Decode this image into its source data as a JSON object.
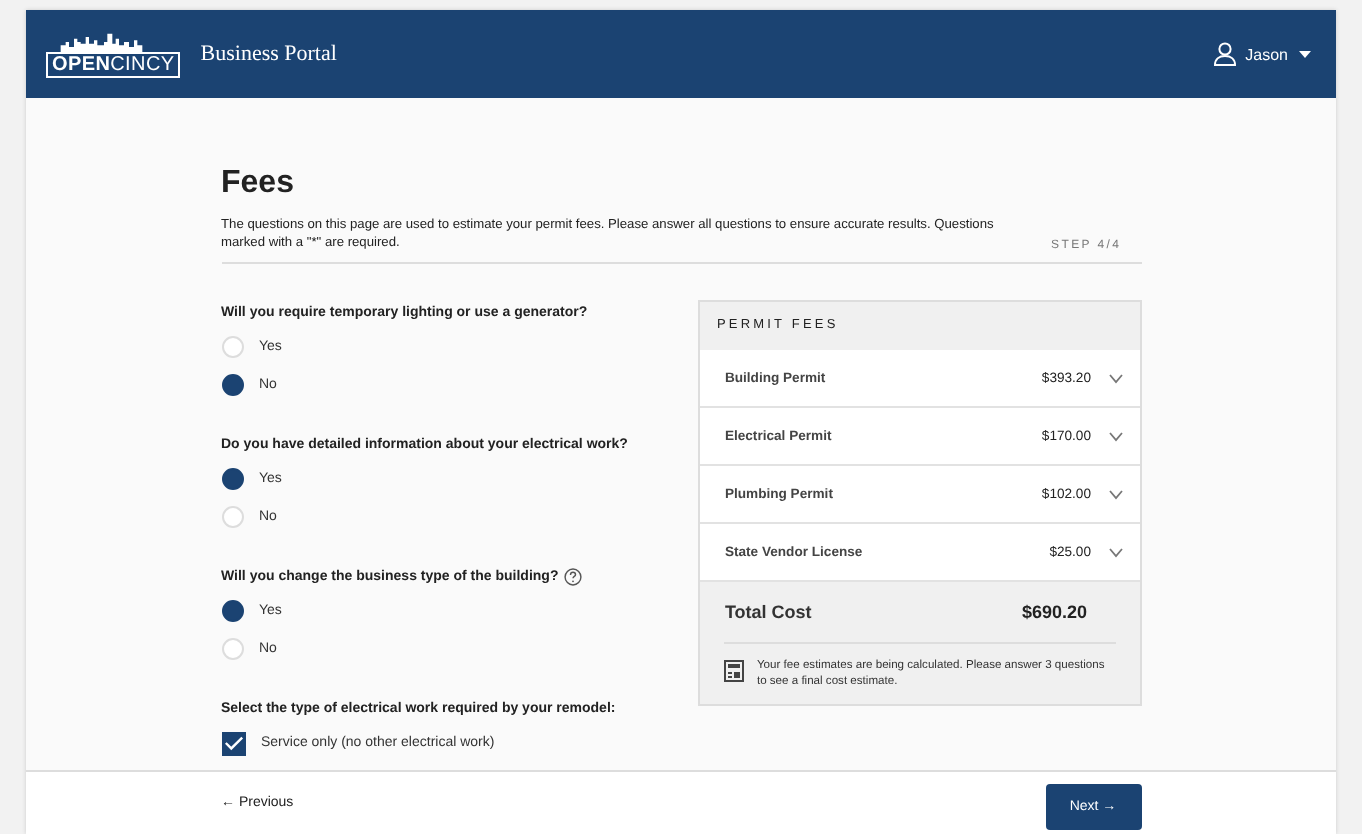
{
  "header": {
    "logo": "**OPEN**CINCY",
    "title": "Business Portal",
    "user": "Jason"
  },
  "page": {
    "title": "Fees",
    "intro": "The questions on this page are used to estimate your permit fees. Please answer all questions to ensure accurate results. Questions marked with a \"*\" are required.",
    "step": "STEP 4/4"
  },
  "questions": [
    {
      "kind": "radio",
      "label": "Will you require temporary lighting or use a generator?",
      "help": false,
      "options": [
        {
          "label": "Yes",
          "selected": false
        },
        {
          "label": "No",
          "selected": true
        }
      ]
    },
    {
      "kind": "radio",
      "label": "Do you have detailed information about your electrical work?",
      "help": false,
      "options": [
        {
          "label": "Yes",
          "selected": true
        },
        {
          "label": "No",
          "selected": false
        }
      ]
    },
    {
      "kind": "radio",
      "label": "Will you change the business type of the building?",
      "help": true,
      "options": [
        {
          "label": "Yes",
          "selected": true
        },
        {
          "label": "No",
          "selected": false
        }
      ]
    },
    {
      "kind": "checkbox",
      "label": "Select the type of electrical work required by your remodel:",
      "help": false,
      "options": [
        {
          "label": "Service only (no other electrical work)",
          "checked": true
        }
      ]
    }
  ],
  "fees": {
    "title": "PERMIT FEES",
    "items": [
      {
        "name": "Building Permit",
        "amount": "$393.20",
        "expanded": false
      },
      {
        "name": "Electrical Permit",
        "amount": "$170.00",
        "expanded": false
      },
      {
        "name": "Plumbing Permit",
        "amount": "$102.00",
        "expanded": false
      },
      {
        "name": "State Vendor License",
        "amount": "$25.00",
        "expanded": false
      }
    ],
    "total_label": "Total Cost",
    "total": "$690.20",
    "note": "Your fee estimates are being calculated. Please answer 3 questions to see a final cost estimate."
  },
  "footer": {
    "previous": "← Previous",
    "next": "Next →"
  }
}
